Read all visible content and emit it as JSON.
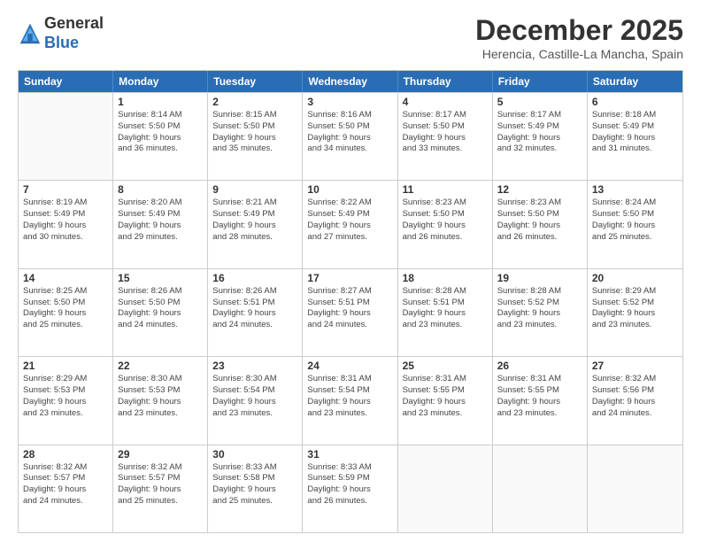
{
  "header": {
    "logo_general": "General",
    "logo_blue": "Blue",
    "month_title": "December 2025",
    "location": "Herencia, Castille-La Mancha, Spain"
  },
  "days_of_week": [
    "Sunday",
    "Monday",
    "Tuesday",
    "Wednesday",
    "Thursday",
    "Friday",
    "Saturday"
  ],
  "weeks": [
    [
      {
        "day": "",
        "info": ""
      },
      {
        "day": "1",
        "info": "Sunrise: 8:14 AM\nSunset: 5:50 PM\nDaylight: 9 hours\nand 36 minutes."
      },
      {
        "day": "2",
        "info": "Sunrise: 8:15 AM\nSunset: 5:50 PM\nDaylight: 9 hours\nand 35 minutes."
      },
      {
        "day": "3",
        "info": "Sunrise: 8:16 AM\nSunset: 5:50 PM\nDaylight: 9 hours\nand 34 minutes."
      },
      {
        "day": "4",
        "info": "Sunrise: 8:17 AM\nSunset: 5:50 PM\nDaylight: 9 hours\nand 33 minutes."
      },
      {
        "day": "5",
        "info": "Sunrise: 8:17 AM\nSunset: 5:49 PM\nDaylight: 9 hours\nand 32 minutes."
      },
      {
        "day": "6",
        "info": "Sunrise: 8:18 AM\nSunset: 5:49 PM\nDaylight: 9 hours\nand 31 minutes."
      }
    ],
    [
      {
        "day": "7",
        "info": "Sunrise: 8:19 AM\nSunset: 5:49 PM\nDaylight: 9 hours\nand 30 minutes."
      },
      {
        "day": "8",
        "info": "Sunrise: 8:20 AM\nSunset: 5:49 PM\nDaylight: 9 hours\nand 29 minutes."
      },
      {
        "day": "9",
        "info": "Sunrise: 8:21 AM\nSunset: 5:49 PM\nDaylight: 9 hours\nand 28 minutes."
      },
      {
        "day": "10",
        "info": "Sunrise: 8:22 AM\nSunset: 5:49 PM\nDaylight: 9 hours\nand 27 minutes."
      },
      {
        "day": "11",
        "info": "Sunrise: 8:23 AM\nSunset: 5:50 PM\nDaylight: 9 hours\nand 26 minutes."
      },
      {
        "day": "12",
        "info": "Sunrise: 8:23 AM\nSunset: 5:50 PM\nDaylight: 9 hours\nand 26 minutes."
      },
      {
        "day": "13",
        "info": "Sunrise: 8:24 AM\nSunset: 5:50 PM\nDaylight: 9 hours\nand 25 minutes."
      }
    ],
    [
      {
        "day": "14",
        "info": "Sunrise: 8:25 AM\nSunset: 5:50 PM\nDaylight: 9 hours\nand 25 minutes."
      },
      {
        "day": "15",
        "info": "Sunrise: 8:26 AM\nSunset: 5:50 PM\nDaylight: 9 hours\nand 24 minutes."
      },
      {
        "day": "16",
        "info": "Sunrise: 8:26 AM\nSunset: 5:51 PM\nDaylight: 9 hours\nand 24 minutes."
      },
      {
        "day": "17",
        "info": "Sunrise: 8:27 AM\nSunset: 5:51 PM\nDaylight: 9 hours\nand 24 minutes."
      },
      {
        "day": "18",
        "info": "Sunrise: 8:28 AM\nSunset: 5:51 PM\nDaylight: 9 hours\nand 23 minutes."
      },
      {
        "day": "19",
        "info": "Sunrise: 8:28 AM\nSunset: 5:52 PM\nDaylight: 9 hours\nand 23 minutes."
      },
      {
        "day": "20",
        "info": "Sunrise: 8:29 AM\nSunset: 5:52 PM\nDaylight: 9 hours\nand 23 minutes."
      }
    ],
    [
      {
        "day": "21",
        "info": "Sunrise: 8:29 AM\nSunset: 5:53 PM\nDaylight: 9 hours\nand 23 minutes."
      },
      {
        "day": "22",
        "info": "Sunrise: 8:30 AM\nSunset: 5:53 PM\nDaylight: 9 hours\nand 23 minutes."
      },
      {
        "day": "23",
        "info": "Sunrise: 8:30 AM\nSunset: 5:54 PM\nDaylight: 9 hours\nand 23 minutes."
      },
      {
        "day": "24",
        "info": "Sunrise: 8:31 AM\nSunset: 5:54 PM\nDaylight: 9 hours\nand 23 minutes."
      },
      {
        "day": "25",
        "info": "Sunrise: 8:31 AM\nSunset: 5:55 PM\nDaylight: 9 hours\nand 23 minutes."
      },
      {
        "day": "26",
        "info": "Sunrise: 8:31 AM\nSunset: 5:55 PM\nDaylight: 9 hours\nand 23 minutes."
      },
      {
        "day": "27",
        "info": "Sunrise: 8:32 AM\nSunset: 5:56 PM\nDaylight: 9 hours\nand 24 minutes."
      }
    ],
    [
      {
        "day": "28",
        "info": "Sunrise: 8:32 AM\nSunset: 5:57 PM\nDaylight: 9 hours\nand 24 minutes."
      },
      {
        "day": "29",
        "info": "Sunrise: 8:32 AM\nSunset: 5:57 PM\nDaylight: 9 hours\nand 25 minutes."
      },
      {
        "day": "30",
        "info": "Sunrise: 8:33 AM\nSunset: 5:58 PM\nDaylight: 9 hours\nand 25 minutes."
      },
      {
        "day": "31",
        "info": "Sunrise: 8:33 AM\nSunset: 5:59 PM\nDaylight: 9 hours\nand 26 minutes."
      },
      {
        "day": "",
        "info": ""
      },
      {
        "day": "",
        "info": ""
      },
      {
        "day": "",
        "info": ""
      }
    ]
  ]
}
